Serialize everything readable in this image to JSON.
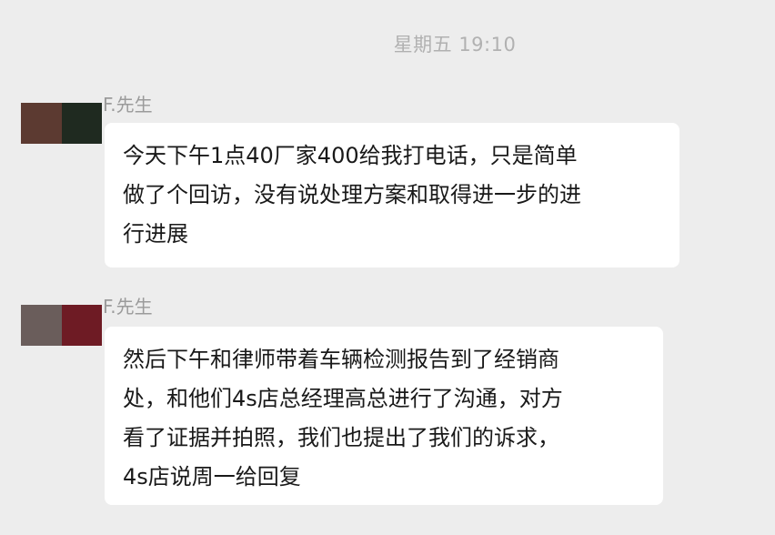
{
  "timestamp": "星期五 19:10",
  "messages": [
    {
      "sender": "F.先生",
      "text": "今天下午1点40厂家400给我打电话，只是简单\n做了个回访，没有说处理方案和取得进一步的进\n行进展",
      "avatar_colors": [
        "#5c3a31",
        "#1f2a20"
      ]
    },
    {
      "sender": "F.先生",
      "text": "然后下午和律师带着车辆检测报告到了经销商\n处，和他们4s店总经理高总进行了沟通，对方\n看了证据并拍照，我们也提出了我们的诉求，\n4s店说周一给回复",
      "avatar_colors": [
        "#6a5d5b",
        "#6e1b24"
      ]
    }
  ]
}
